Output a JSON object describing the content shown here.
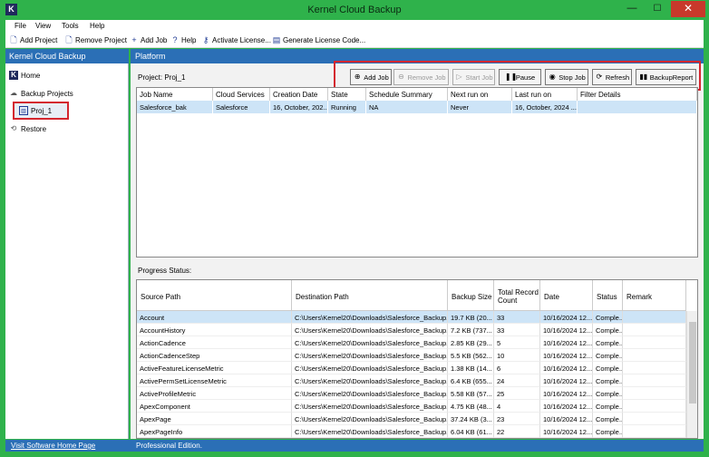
{
  "window": {
    "title": "Kernel Cloud Backup",
    "app_icon_letter": "K",
    "minimize": "—",
    "maximize": "☐",
    "close": "✕"
  },
  "menu": [
    "File",
    "View",
    "Tools",
    "Help"
  ],
  "toolbar": {
    "add_project": "Add Project",
    "remove_project": "Remove Project",
    "add_job": "Add Job",
    "help": "Help",
    "activate_license": "Activate License...",
    "generate_license": "Generate License Code..."
  },
  "sidebar": {
    "header": "Kernel Cloud Backup",
    "items": [
      {
        "label": "Home",
        "icon": "app-logo-icon"
      },
      {
        "label": "Backup Projects",
        "icon": "cloud-icon"
      },
      {
        "label": "Proj_1",
        "icon": "document-icon"
      },
      {
        "label": "Restore",
        "icon": "restore-icon"
      }
    ]
  },
  "main": {
    "header": "Platform",
    "project_label": "Project: Proj_1",
    "actions": {
      "add_job": "Add Job",
      "remove_job": "Remove Job",
      "start_job": "Start Job",
      "pause": "Pause",
      "stop_job": "Stop Job",
      "refresh": "Refresh",
      "backup_report": "BackupReport"
    },
    "jobs_columns": [
      "Job Name",
      "Cloud Services",
      "Creation Date",
      "State",
      "Schedule Summary",
      "Next run on",
      "Last run on",
      "Filter Details"
    ],
    "jobs_rows": [
      [
        "Salesforce_bak",
        "Salesforce",
        "16, October, 202...",
        "Running",
        "NA",
        "Never",
        "16, October, 2024 ...",
        ""
      ]
    ],
    "progress_label": "Progress Status:",
    "progress_columns": [
      "Source Path",
      "Destination Path",
      "Backup Size",
      "Total Record Count",
      "Date",
      "Status",
      "Remark"
    ],
    "progress_rows": [
      [
        "Account",
        "C:\\Users\\Kernel20\\Downloads\\Salesforce_Backup...",
        "19.7 KB (20...",
        "33",
        "10/16/2024 12...",
        "Comple...",
        ""
      ],
      [
        "AccountHistory",
        "C:\\Users\\Kernel20\\Downloads\\Salesforce_Backup...",
        "7.2 KB (737...",
        "33",
        "10/16/2024 12...",
        "Comple...",
        ""
      ],
      [
        "ActionCadence",
        "C:\\Users\\Kernel20\\Downloads\\Salesforce_Backup...",
        "2.85 KB (29...",
        "5",
        "10/16/2024 12...",
        "Comple...",
        ""
      ],
      [
        "ActionCadenceStep",
        "C:\\Users\\Kernel20\\Downloads\\Salesforce_Backup...",
        "5.5 KB (562...",
        "10",
        "10/16/2024 12...",
        "Comple...",
        ""
      ],
      [
        "ActiveFeatureLicenseMetric",
        "C:\\Users\\Kernel20\\Downloads\\Salesforce_Backup...",
        "1.38 KB (14...",
        "6",
        "10/16/2024 12...",
        "Comple...",
        ""
      ],
      [
        "ActivePermSetLicenseMetric",
        "C:\\Users\\Kernel20\\Downloads\\Salesforce_Backup...",
        "6.4 KB (655...",
        "24",
        "10/16/2024 12...",
        "Comple...",
        ""
      ],
      [
        "ActiveProfileMetric",
        "C:\\Users\\Kernel20\\Downloads\\Salesforce_Backup...",
        "5.58 KB (57...",
        "25",
        "10/16/2024 12...",
        "Comple...",
        ""
      ],
      [
        "ApexComponent",
        "C:\\Users\\Kernel20\\Downloads\\Salesforce_Backup...",
        "4.75 KB (48...",
        "4",
        "10/16/2024 12...",
        "Comple...",
        ""
      ],
      [
        "ApexPage",
        "C:\\Users\\Kernel20\\Downloads\\Salesforce_Backup...",
        "37.24 KB (3...",
        "23",
        "10/16/2024 12...",
        "Comple...",
        ""
      ],
      [
        "ApexPageInfo",
        "C:\\Users\\Kernel20\\Downloads\\Salesforce_Backup...",
        "6.04 KB (61...",
        "22",
        "10/16/2024 12...",
        "Comple...",
        ""
      ]
    ]
  },
  "statusbar": {
    "link": "Visit Software Home Page",
    "edition": "Professional Edition."
  },
  "colors": {
    "title_bar": "#2fb24b",
    "panel_header": "#2b6fb6",
    "selection": "#cde4f7",
    "highlight_border": "#d4262f"
  }
}
